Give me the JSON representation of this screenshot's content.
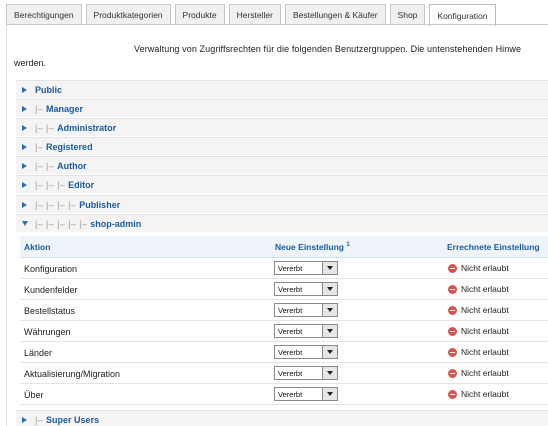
{
  "tabs": [
    {
      "label": "Berechtigungen",
      "active": false
    },
    {
      "label": "Produktkategorien",
      "active": false
    },
    {
      "label": "Produkte",
      "active": false
    },
    {
      "label": "Hersteller",
      "active": false
    },
    {
      "label": "Bestellungen & Käufer",
      "active": false
    },
    {
      "label": "Shop",
      "active": false
    },
    {
      "label": "Konfiguration",
      "active": true
    }
  ],
  "description": {
    "line1": "Verwaltung von Zugriffsrechten für die folgenden Benutzergruppen. Die untenstehenden Hinwe",
    "line2": "werden."
  },
  "groups": [
    {
      "tree": "",
      "name": "Public"
    },
    {
      "tree": "|– ",
      "name": "Manager"
    },
    {
      "tree": "|– |– ",
      "name": "Administrator"
    },
    {
      "tree": "|– ",
      "name": "Registered"
    },
    {
      "tree": "|– |– ",
      "name": "Author"
    },
    {
      "tree": "|– |– |– ",
      "name": "Editor"
    },
    {
      "tree": "|– |– |– |– ",
      "name": "Publisher"
    },
    {
      "tree": "|– |– |– |– |– ",
      "name": "shop-admin"
    },
    {
      "tree": "|– ",
      "name": "Super Users"
    }
  ],
  "permissions": {
    "headers": {
      "action": "Aktion",
      "new_setting": "Neue Einstellung",
      "new_setting_sup": "1",
      "calculated": "Errechnete Einstellung"
    },
    "rows": [
      {
        "action": "Konfiguration",
        "setting": "Vererbt",
        "calculated": "Nicht erlaubt"
      },
      {
        "action": "Kundenfelder",
        "setting": "Vererbt",
        "calculated": "Nicht erlaubt"
      },
      {
        "action": "Bestellstatus",
        "setting": "Vererbt",
        "calculated": "Nicht erlaubt"
      },
      {
        "action": "Währungen",
        "setting": "Vererbt",
        "calculated": "Nicht erlaubt"
      },
      {
        "action": "Länder",
        "setting": "Vererbt",
        "calculated": "Nicht erlaubt"
      },
      {
        "action": "Aktualisierung/Migration",
        "setting": "Vererbt",
        "calculated": "Nicht erlaubt"
      },
      {
        "action": "Über",
        "setting": "Vererbt",
        "calculated": "Nicht erlaubt"
      }
    ]
  },
  "colors": {
    "accent": "#1a5b9c",
    "arrow": "#2f6db3",
    "denied": "#d9534f",
    "group_bg": "#f4f4f4"
  },
  "icons": {
    "expand": "triangle-right-icon",
    "collapse": "triangle-down-icon",
    "denied": "no-entry-icon",
    "dropdown": "chevron-down-icon"
  }
}
